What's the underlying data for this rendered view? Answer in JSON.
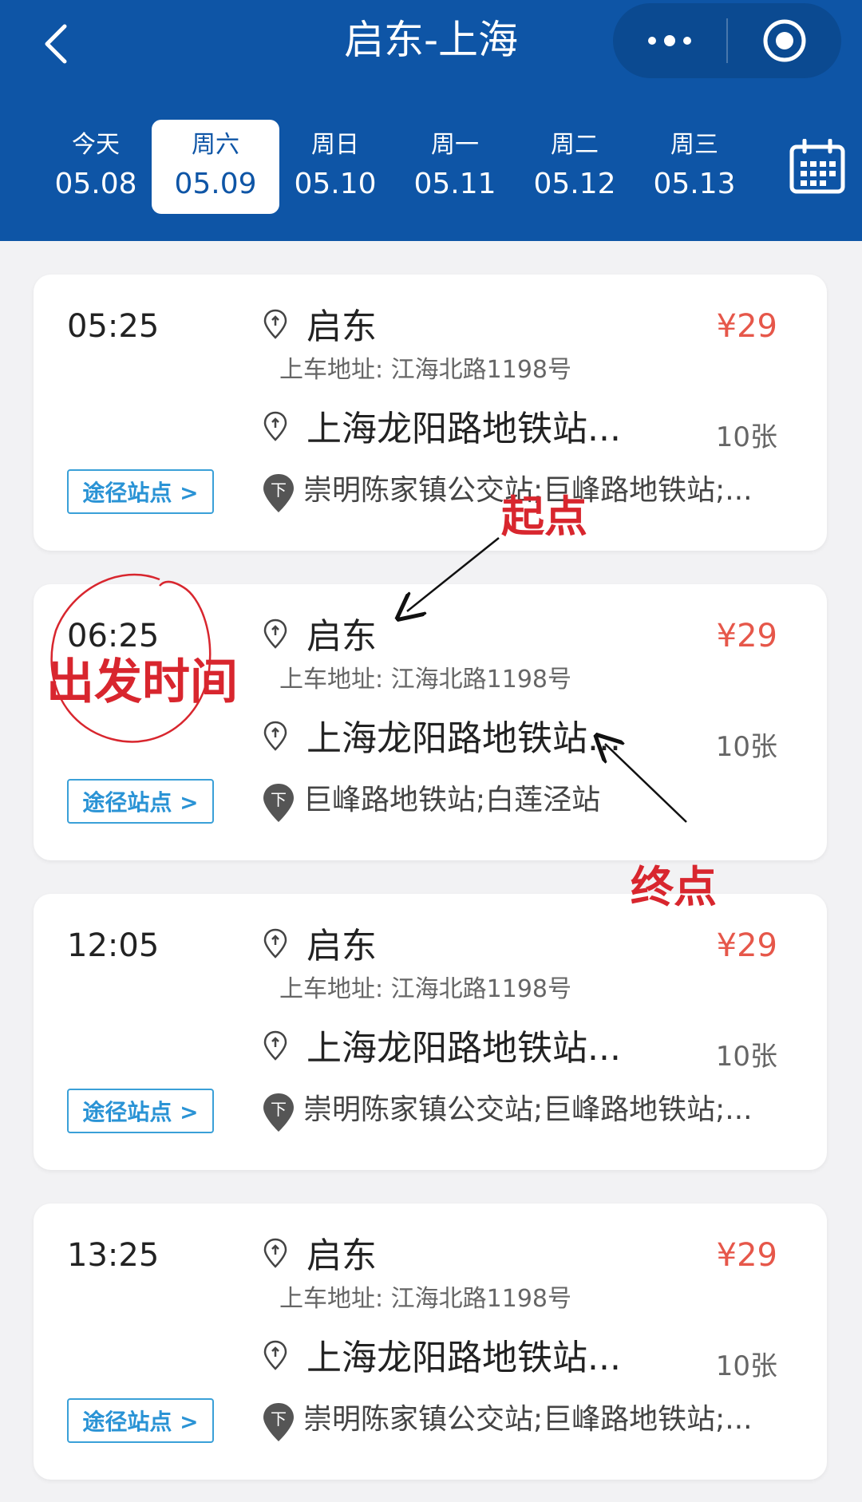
{
  "header": {
    "title": "启东-上海",
    "back_icon": "chevron-left-icon",
    "more_icon": "more-dots-icon",
    "close_icon": "target-circle-icon",
    "calendar_icon": "calendar-icon"
  },
  "days": [
    {
      "name": "今天",
      "date": "05.08"
    },
    {
      "name": "周六",
      "date": "05.09",
      "selected": true
    },
    {
      "name": "周日",
      "date": "05.10"
    },
    {
      "name": "周一",
      "date": "05.11"
    },
    {
      "name": "周二",
      "date": "05.12"
    },
    {
      "name": "周三",
      "date": "05.13"
    }
  ],
  "trips": [
    {
      "time": "05:25",
      "from": "启东",
      "address": "上车地址: 江海北路1198号",
      "to": "上海龙阳路地铁站...",
      "price": "¥29",
      "tickets": "10张",
      "stops_button": "途径站点 >",
      "stops": "崇明陈家镇公交站;巨峰路地铁站;..."
    },
    {
      "time": "06:25",
      "from": "启东",
      "address": "上车地址: 江海北路1198号",
      "to": "上海龙阳路地铁站...",
      "price": "¥29",
      "tickets": "10张",
      "stops_button": "途径站点 >",
      "stops": "巨峰路地铁站;白莲泾站"
    },
    {
      "time": "12:05",
      "from": "启东",
      "address": "上车地址: 江海北路1198号",
      "to": "上海龙阳路地铁站...",
      "price": "¥29",
      "tickets": "10张",
      "stops_button": "途径站点 >",
      "stops": "崇明陈家镇公交站;巨峰路地铁站;..."
    },
    {
      "time": "13:25",
      "from": "启东",
      "address": "上车地址: 江海北路1198号",
      "to": "上海龙阳路地铁站...",
      "price": "¥29",
      "tickets": "10张",
      "stops_button": "途径站点 >",
      "stops": "崇明陈家镇公交站;巨峰路地铁站;..."
    }
  ],
  "annotations": {
    "origin": "起点",
    "destination": "终点",
    "departure_time": "出发时间"
  },
  "colors": {
    "header_bg": "#0e55a6",
    "price": "#e6574a",
    "annotation": "#d8262e",
    "stops_button": "#2a93d5"
  }
}
